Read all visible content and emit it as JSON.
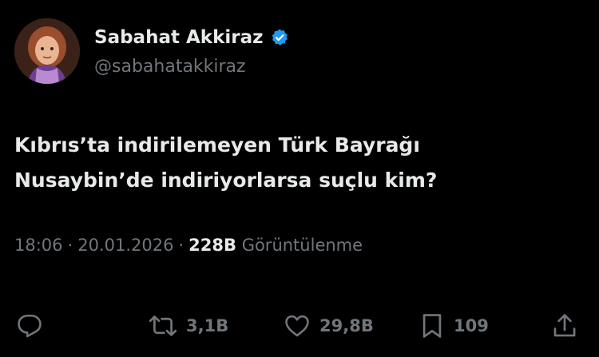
{
  "author": {
    "display_name": "Sabahat Akkiraz",
    "handle": "@sabahatakkiraz",
    "verified": true,
    "verified_color": "#1d9bf0"
  },
  "tweet": {
    "lines": [
      "Kıbrıs’ta indirilemeyen Türk Bayrağı",
      "Nusaybin’de indiriyorlarsa suçlu kim?"
    ]
  },
  "meta": {
    "time": "18:06",
    "separator": "·",
    "date": "20.01.2026",
    "views_count": "228B",
    "views_label": "Görüntülenme"
  },
  "actions": {
    "reply": {
      "icon": "reply-icon",
      "count": ""
    },
    "retweet": {
      "icon": "retweet-icon",
      "count": "3,1B"
    },
    "like": {
      "icon": "heart-icon",
      "count": "29,8B"
    },
    "bookmark": {
      "icon": "bookmark-icon",
      "count": "109"
    },
    "share": {
      "icon": "share-icon"
    }
  },
  "colors": {
    "background": "#000000",
    "primary_text": "#e7e9ea",
    "secondary_text": "#71767b"
  }
}
